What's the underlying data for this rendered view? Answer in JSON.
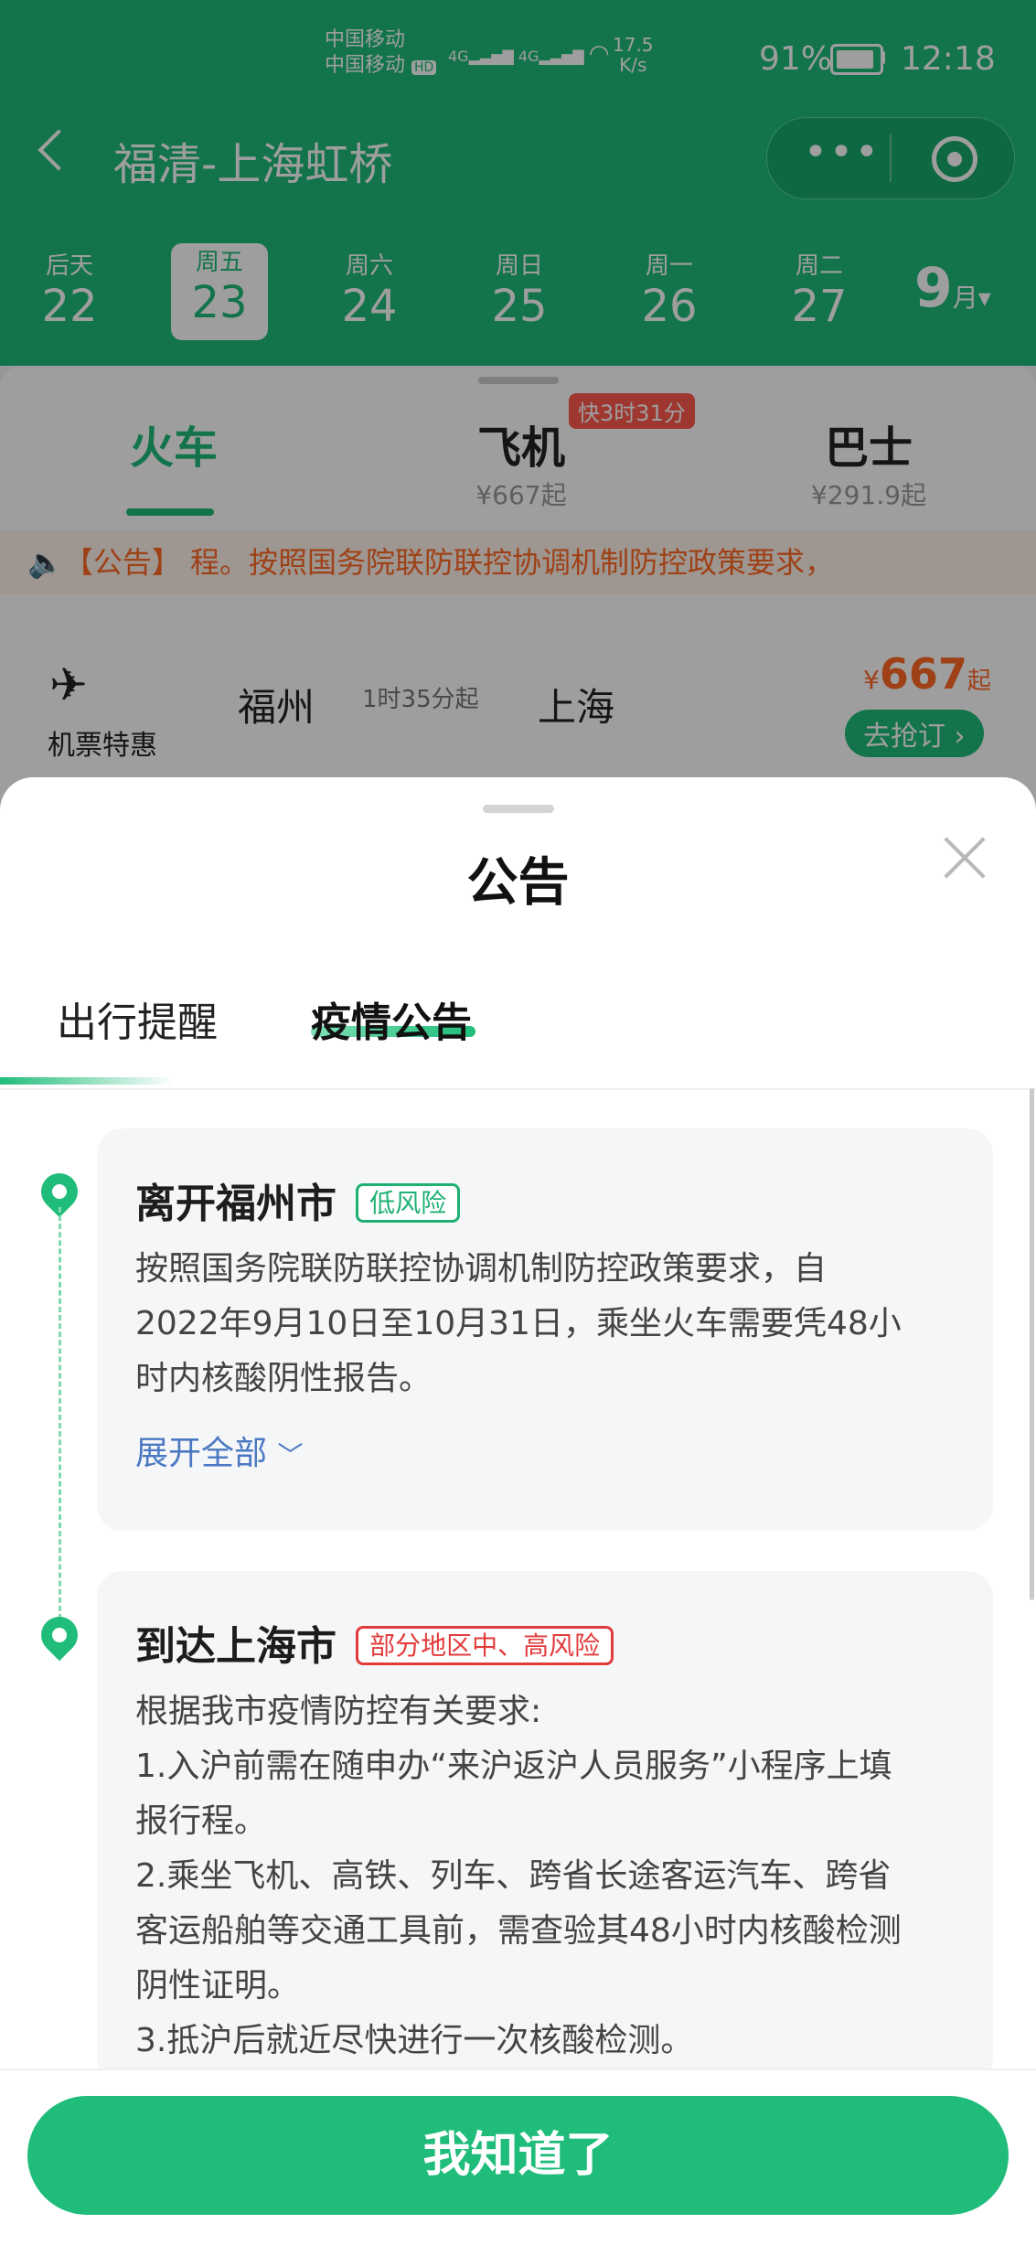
{
  "status": {
    "carrier1": "中国移动",
    "carrier2": "中国移动",
    "hd": "HD",
    "signal1": "4G",
    "signal2": "4G",
    "speed": "17.5",
    "speed_unit": "K/s",
    "battery": "91%",
    "time": "12:18"
  },
  "header": {
    "title": "福清-上海虹桥",
    "more_icon": "more-dots-icon",
    "target_icon": "target-icon"
  },
  "dates": [
    {
      "week": "后天",
      "day": "22"
    },
    {
      "week": "周五",
      "day": "23"
    },
    {
      "week": "周六",
      "day": "24"
    },
    {
      "week": "周日",
      "day": "25"
    },
    {
      "week": "周一",
      "day": "26"
    },
    {
      "week": "周二",
      "day": "27"
    }
  ],
  "month": {
    "num": "9",
    "unit": "月"
  },
  "modes": [
    {
      "name": "火车",
      "price": ""
    },
    {
      "name": "飞机",
      "price": "¥667起"
    },
    {
      "name": "巴士",
      "price": "¥291.9起"
    }
  ],
  "fast_badge": "快3时31分",
  "notice": "【公告】 程。按照国务院联防联控协调机制防控政策要求，",
  "flight": {
    "label": "机票特惠",
    "from": "福州",
    "duration": "1时35分起",
    "to": "上海",
    "price_symbol": "¥",
    "price": "667",
    "price_suffix": "起",
    "book": "去抢订"
  },
  "sheet": {
    "title": "公告",
    "tab1": "出行提醒",
    "tab2": "疫情公告"
  },
  "cards": [
    {
      "title": "离开福州市",
      "badge": "低风险",
      "lines": [
        "按照国务院联防联控协调机制防控政策要求，自",
        "2022年9月10日至10月31日，乘坐火车需要凭48小",
        "时内核酸阴性报告。"
      ],
      "expand": "展开全部"
    },
    {
      "title": "到达上海市",
      "badge": "部分地区中、高风险",
      "lines": [
        "根据我市疫情防控有关要求:",
        "1.入沪前需在随申办“来沪返沪人员服务”小程序上填",
        "报行程。",
        "2.乘坐飞机、高铁、列车、跨省长途客运汽车、跨省",
        "客运船舶等交通工具前，需查验其48小时内核酸检测",
        "阴性证明。",
        "3.抵沪后就近尽快进行一次核酸检测。"
      ]
    }
  ],
  "ok_button": "我知道了"
}
